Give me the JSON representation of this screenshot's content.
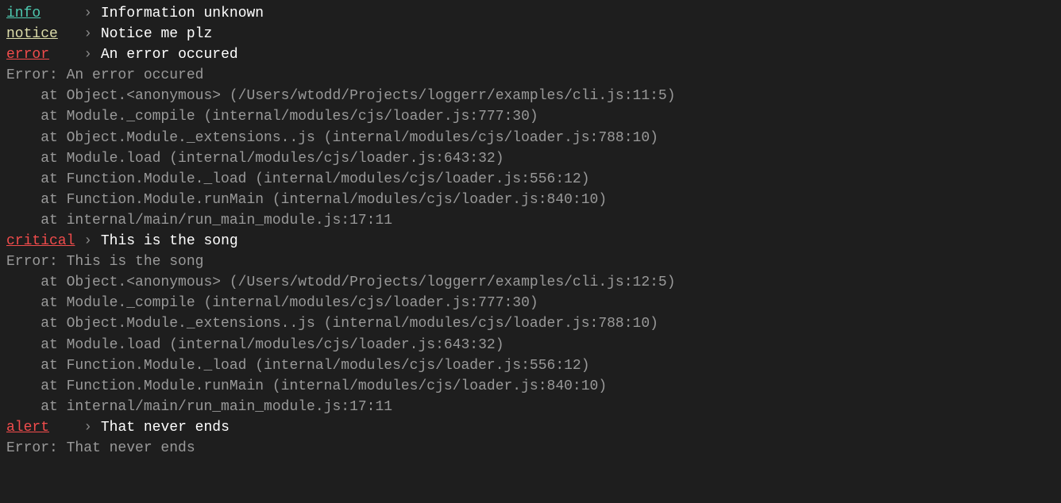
{
  "colors": {
    "info": "#4ec9b0",
    "notice": "#dcdcaa",
    "error": "#f14c4c",
    "critical": "#f14c4c",
    "alert": "#f14c4c",
    "background": "#1e1e1e",
    "message": "#ffffff",
    "stackTrace": "#999999",
    "arrow": "#888888"
  },
  "arrow": "›",
  "entries": [
    {
      "level": "info",
      "levelPadded": "info    ",
      "message": "Information unknown",
      "stackTrace": null
    },
    {
      "level": "notice",
      "levelPadded": "notice  ",
      "message": "Notice me plz",
      "stackTrace": null
    },
    {
      "level": "error",
      "levelPadded": "error   ",
      "message": "An error occured",
      "stackTrace": [
        "Error: An error occured",
        "    at Object.<anonymous> (/Users/wtodd/Projects/loggerr/examples/cli.js:11:5)",
        "    at Module._compile (internal/modules/cjs/loader.js:777:30)",
        "    at Object.Module._extensions..js (internal/modules/cjs/loader.js:788:10)",
        "    at Module.load (internal/modules/cjs/loader.js:643:32)",
        "    at Function.Module._load (internal/modules/cjs/loader.js:556:12)",
        "    at Function.Module.runMain (internal/modules/cjs/loader.js:840:10)",
        "    at internal/main/run_main_module.js:17:11"
      ]
    },
    {
      "level": "critical",
      "levelPadded": "critical",
      "message": "This is the song",
      "stackTrace": [
        "Error: This is the song",
        "    at Object.<anonymous> (/Users/wtodd/Projects/loggerr/examples/cli.js:12:5)",
        "    at Module._compile (internal/modules/cjs/loader.js:777:30)",
        "    at Object.Module._extensions..js (internal/modules/cjs/loader.js:788:10)",
        "    at Module.load (internal/modules/cjs/loader.js:643:32)",
        "    at Function.Module._load (internal/modules/cjs/loader.js:556:12)",
        "    at Function.Module.runMain (internal/modules/cjs/loader.js:840:10)",
        "    at internal/main/run_main_module.js:17:11"
      ]
    },
    {
      "level": "alert",
      "levelPadded": "alert   ",
      "message": "That never ends",
      "stackTrace": [
        "Error: That never ends"
      ]
    }
  ]
}
